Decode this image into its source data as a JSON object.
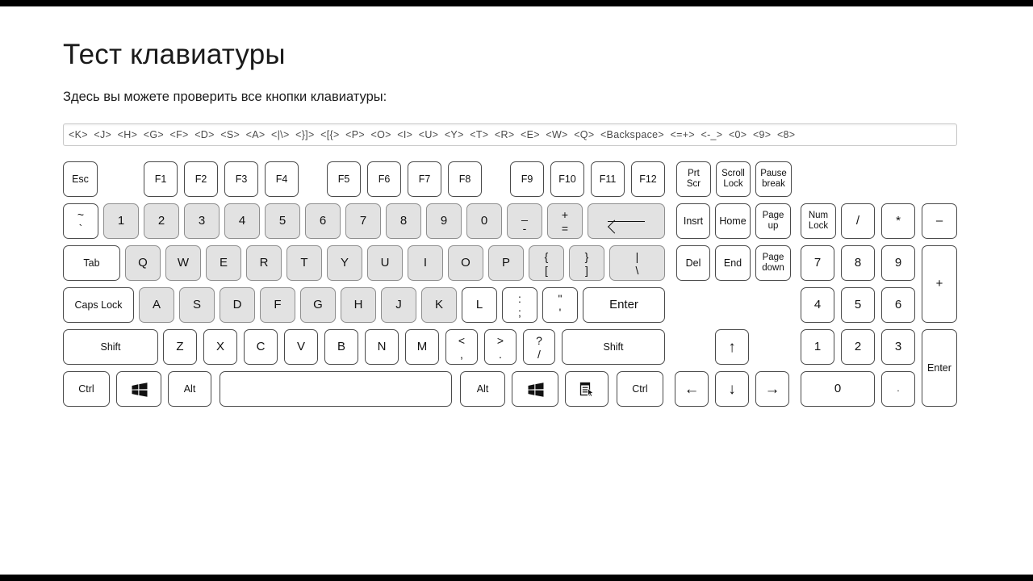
{
  "page": {
    "title": "Тест клавиатуры",
    "subtitle": "Здесь вы можете проверить все кнопки клавиатуры:"
  },
  "key_log_input": {
    "value": "<K>  <J>  <H>  <G>  <F>  <D>  <S>  <A>  <|\\>  <}]>  <[{>  <P>  <O>  <I>  <U>  <Y>  <T>  <R>  <E>  <W>  <Q>  <Backspace>  <=+>  <-_>  <0>  <9>  <8>",
    "placeholder": ""
  },
  "keyboard": {
    "rows": {
      "function": [
        {
          "label": "Esc"
        },
        {
          "label": "F1"
        },
        {
          "label": "F2"
        },
        {
          "label": "F3"
        },
        {
          "label": "F4"
        },
        {
          "label": "F5"
        },
        {
          "label": "F6"
        },
        {
          "label": "F7"
        },
        {
          "label": "F8"
        },
        {
          "label": "F9"
        },
        {
          "label": "F10"
        },
        {
          "label": "F11"
        },
        {
          "label": "F12"
        },
        {
          "line1": "Prt",
          "line2": "Scr"
        },
        {
          "line1": "Scroll",
          "line2": "Lock"
        },
        {
          "line1": "Pause",
          "line2": "break"
        }
      ],
      "number": [
        {
          "top": "~",
          "bottom": "`"
        },
        {
          "label": "1"
        },
        {
          "label": "2"
        },
        {
          "label": "3"
        },
        {
          "label": "4"
        },
        {
          "label": "5"
        },
        {
          "label": "6"
        },
        {
          "label": "7"
        },
        {
          "label": "8"
        },
        {
          "label": "9"
        },
        {
          "label": "0"
        },
        {
          "top": "_",
          "bottom": "-"
        },
        {
          "top": "+",
          "bottom": "="
        },
        {
          "label": "Backspace"
        }
      ],
      "qwerty": [
        {
          "label": "Tab"
        },
        {
          "label": "Q"
        },
        {
          "label": "W"
        },
        {
          "label": "E"
        },
        {
          "label": "R"
        },
        {
          "label": "T"
        },
        {
          "label": "Y"
        },
        {
          "label": "U"
        },
        {
          "label": "I"
        },
        {
          "label": "O"
        },
        {
          "label": "P"
        },
        {
          "top": "{",
          "bottom": "["
        },
        {
          "top": "}",
          "bottom": "]"
        },
        {
          "top": "|",
          "bottom": "\\"
        }
      ],
      "home": [
        {
          "label": "Caps Lock"
        },
        {
          "label": "A"
        },
        {
          "label": "S"
        },
        {
          "label": "D"
        },
        {
          "label": "F"
        },
        {
          "label": "G"
        },
        {
          "label": "H"
        },
        {
          "label": "J"
        },
        {
          "label": "K"
        },
        {
          "label": "L"
        },
        {
          "top": ":",
          "bottom": ";"
        },
        {
          "top": "\"",
          "bottom": "'"
        },
        {
          "label": "Enter"
        }
      ],
      "shift": [
        {
          "label": "Shift"
        },
        {
          "label": "Z"
        },
        {
          "label": "X"
        },
        {
          "label": "C"
        },
        {
          "label": "V"
        },
        {
          "label": "B"
        },
        {
          "label": "N"
        },
        {
          "label": "M"
        },
        {
          "top": "<",
          "bottom": ","
        },
        {
          "top": ">",
          "bottom": "."
        },
        {
          "top": "?",
          "bottom": "/"
        },
        {
          "label": "Shift"
        }
      ],
      "bottom": [
        {
          "label": "Ctrl"
        },
        {
          "icon": "windows-logo-icon"
        },
        {
          "label": "Alt"
        },
        {
          "label": ""
        },
        {
          "label": "Alt"
        },
        {
          "icon": "windows-logo-icon"
        },
        {
          "icon": "context-menu-icon"
        },
        {
          "label": "Ctrl"
        }
      ],
      "navigation": [
        {
          "label": "Insrt"
        },
        {
          "label": "Home"
        },
        {
          "line1": "Page",
          "line2": "up"
        },
        {
          "label": "Del"
        },
        {
          "label": "End"
        },
        {
          "line1": "Page",
          "line2": "down"
        }
      ],
      "arrows": [
        {
          "label": "↑",
          "name": "arrow-up-key"
        },
        {
          "label": "←",
          "name": "arrow-left-key"
        },
        {
          "label": "↓",
          "name": "arrow-down-key"
        },
        {
          "label": "→",
          "name": "arrow-right-key"
        }
      ],
      "numpad": [
        {
          "line1": "Num",
          "line2": "Lock"
        },
        {
          "label": "/"
        },
        {
          "label": "*"
        },
        {
          "label": "–"
        },
        {
          "label": "7"
        },
        {
          "label": "8"
        },
        {
          "label": "9"
        },
        {
          "label": "+"
        },
        {
          "label": "4"
        },
        {
          "label": "5"
        },
        {
          "label": "6"
        },
        {
          "label": "1"
        },
        {
          "label": "2"
        },
        {
          "label": "3"
        },
        {
          "label": "Enter"
        },
        {
          "label": "0"
        },
        {
          "label": ".",
          "alt": ","
        }
      ]
    }
  },
  "colors": {
    "key_face": "#ffffff",
    "key_pressed": "#e2e2e2",
    "key_border": "#4a4a4a",
    "page_background": "#ffffff",
    "letterbox": "#000000",
    "text": "#111111"
  }
}
